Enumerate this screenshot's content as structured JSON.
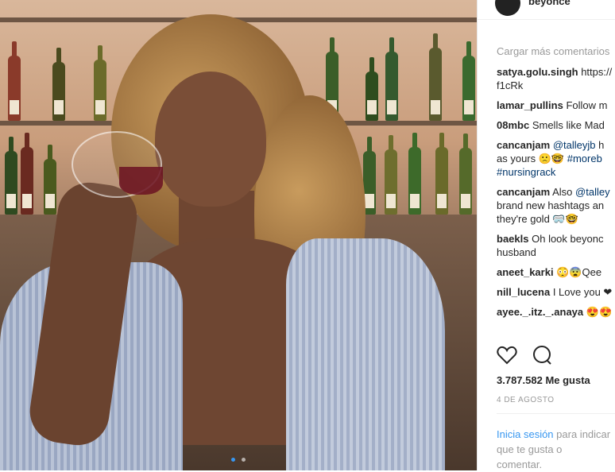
{
  "post": {
    "username": "beyonce",
    "load_more": "Cargar más comentarios",
    "likes": "3.787.582 Me gusta",
    "date": "4 DE AGOSTO",
    "login_link": "Inicia sesión",
    "login_rest": "para indicar que te gusta o",
    "login_line2": "comentar.",
    "icons": {
      "like": "heart-icon",
      "comment": "comment-icon"
    },
    "carousel": {
      "count": 2,
      "active": 1
    }
  },
  "comments": [
    {
      "user": "satya.golu.singh",
      "text": "https://",
      "line2": "f1cRk"
    },
    {
      "user": "lamar_pullins",
      "text": "Follow m"
    },
    {
      "user": "08mbc",
      "text": "Smells like Mad"
    },
    {
      "user": "cancanjam",
      "mention": "@talleyjb",
      "text": "h",
      "line2": "as yours 🙁🤓",
      "tag1": "#moreb",
      "line3": "#nursingrack"
    },
    {
      "user": "cancanjam",
      "text": "Also",
      "mention": "@talley",
      "line2": "brand new hashtags an",
      "line3": "they're gold 🥽🤓"
    },
    {
      "user": "baekls",
      "text": "Oh look beyonc",
      "line2": "husband"
    },
    {
      "user": "aneet_karki",
      "text": "😳😨Qee"
    },
    {
      "user": "nill_lucena",
      "text": "I Love you ❤"
    },
    {
      "user": "ayee._.itz._.anaya",
      "text": "😍😍"
    }
  ],
  "colors": {
    "link": "#003569",
    "accent": "#3897f0",
    "text": "#262626",
    "muted": "#999999"
  }
}
